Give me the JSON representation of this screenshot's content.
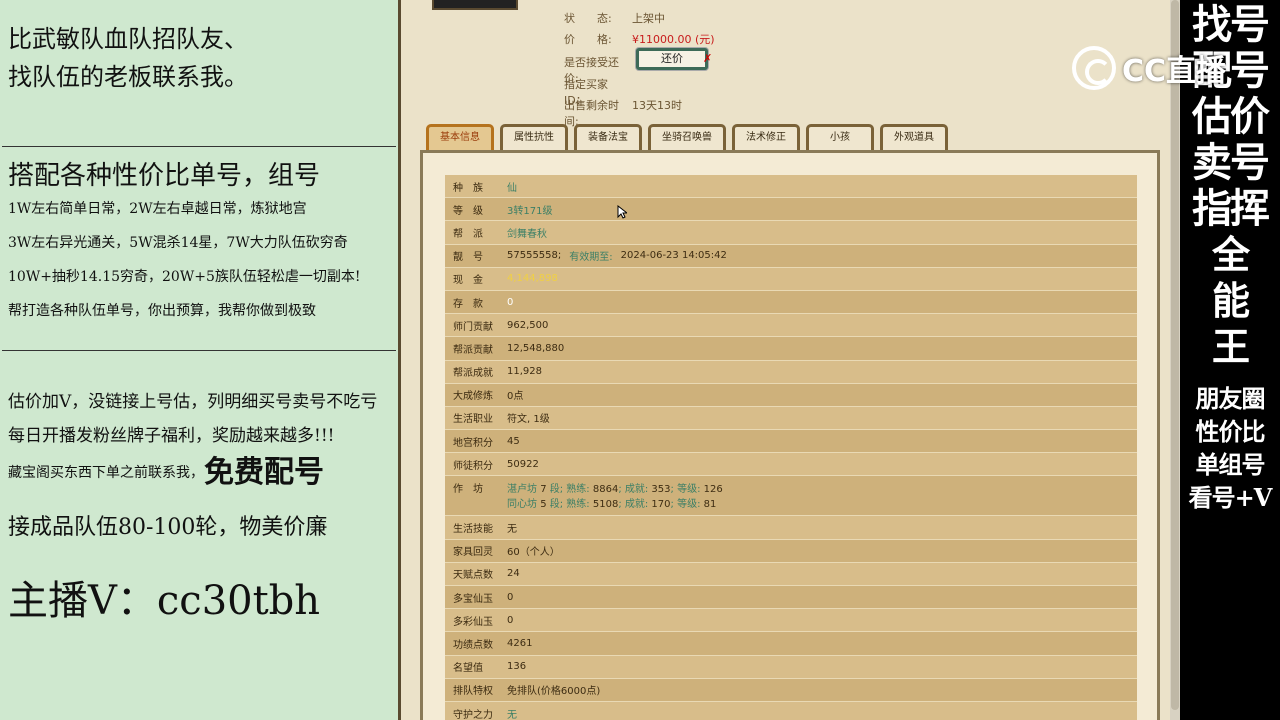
{
  "left_panel": {
    "line1": "比武敏队血队招队友、",
    "line2": "找队伍的老板联系我。",
    "line3": "搭配各种性价比单号，组号",
    "line4": "1W左右简单日常，2W左右卓越日常，炼狱地宫",
    "line5": "3W左右异光通关，5W混杀14星，7W大力队伍砍穷奇",
    "line6": "10W+抽秒14.15穷奇，20W+5族队伍轻松虐一切副本!",
    "line7": "帮打造各种队伍单号，你出预算，我帮你做到极致",
    "line8": "估价加V，没链接上号估，列明细买号卖号不吃亏",
    "line9": "每日开播发粉丝牌子福利，奖励越来越多!!!",
    "line10_a": "藏宝阁买东西下单之前联系我，",
    "line10_b": "免费配号",
    "line11": "接成品队伍80-100轮，物美价廉",
    "line12": "主播V：cc30tbh"
  },
  "listing": {
    "status_label": "状　　态:",
    "status_value": "上架中",
    "price_label": "价　　格:",
    "price_value": "¥11000.00 (元)",
    "counter_label": "是否接受还价:",
    "counter_button": "还价",
    "counter_x": "✗",
    "buyer_label": "指定买家 ID：",
    "buyer_value": "",
    "time_label": "出售剩余时间:",
    "time_value": "13天13时"
  },
  "tabs": [
    "基本信息",
    "属性抗性",
    "装备法宝",
    "坐骑召唤兽",
    "法术修正",
    "小孩",
    "外观道具"
  ],
  "info_rows": [
    {
      "k": "种　族",
      "v": "仙",
      "style": "green"
    },
    {
      "k": "等　级",
      "v": "3转171级",
      "style": "green"
    },
    {
      "k": "帮　派",
      "v": "剑舞春秋",
      "style": "green"
    },
    {
      "k": "靓　号",
      "v": "57555558;",
      "v2": "有效期至:",
      "v3": "2024-06-23 14:05:42",
      "style": "plain"
    },
    {
      "k": "现　金",
      "v": "4,144,898",
      "style": "yellow"
    },
    {
      "k": "存　款",
      "v": "0",
      "style": "white"
    },
    {
      "k": "师门贡献",
      "v": "962,500",
      "style": "plain"
    },
    {
      "k": "帮派贡献",
      "v": "12,548,880",
      "style": "plain"
    },
    {
      "k": "帮派成就",
      "v": "11,928",
      "style": "plain"
    },
    {
      "k": "大成修炼",
      "v": "0点",
      "style": "plain"
    },
    {
      "k": "生活职业",
      "v": "符文, 1级",
      "style": "plain"
    },
    {
      "k": "地宫积分",
      "v": "45",
      "style": "plain"
    },
    {
      "k": "师徒积分",
      "v": "50922",
      "style": "plain"
    }
  ],
  "workshop": {
    "k": "作　坊",
    "line1": {
      "name": "湛卢坊",
      "level": "7",
      "a": "段; 熟练:",
      "n1": "8864",
      "b": "; 成就:",
      "n2": "353",
      "c": "; 等级:",
      "n3": "126"
    },
    "line2": {
      "name": "同心坊",
      "level": "5",
      "a": "段; 熟练:",
      "n1": "5108",
      "b": "; 成就:",
      "n2": "170",
      "c": "; 等级:",
      "n3": "81"
    }
  },
  "info_rows_2": [
    {
      "k": "生活技能",
      "v": "无"
    },
    {
      "k": "家具回灵",
      "v": "60（个人）"
    },
    {
      "k": "天赋点数",
      "v": "24"
    },
    {
      "k": "多宝仙玉",
      "v": "0"
    },
    {
      "k": "多彩仙玉",
      "v": "0"
    },
    {
      "k": "功绩点数",
      "v": "4261"
    },
    {
      "k": "名望值",
      "v": "136"
    },
    {
      "k": "排队特权",
      "v": "免排队(价格6000点)"
    },
    {
      "k": "守护之力",
      "v": "无"
    }
  ],
  "right_panel": {
    "big": [
      "找号",
      "配号",
      "估价",
      "卖号",
      "指挥",
      "全",
      "能",
      "王"
    ],
    "small": [
      "朋友圈",
      "性价比",
      "单组号",
      "看号+V"
    ]
  },
  "watermark": "CC直播"
}
